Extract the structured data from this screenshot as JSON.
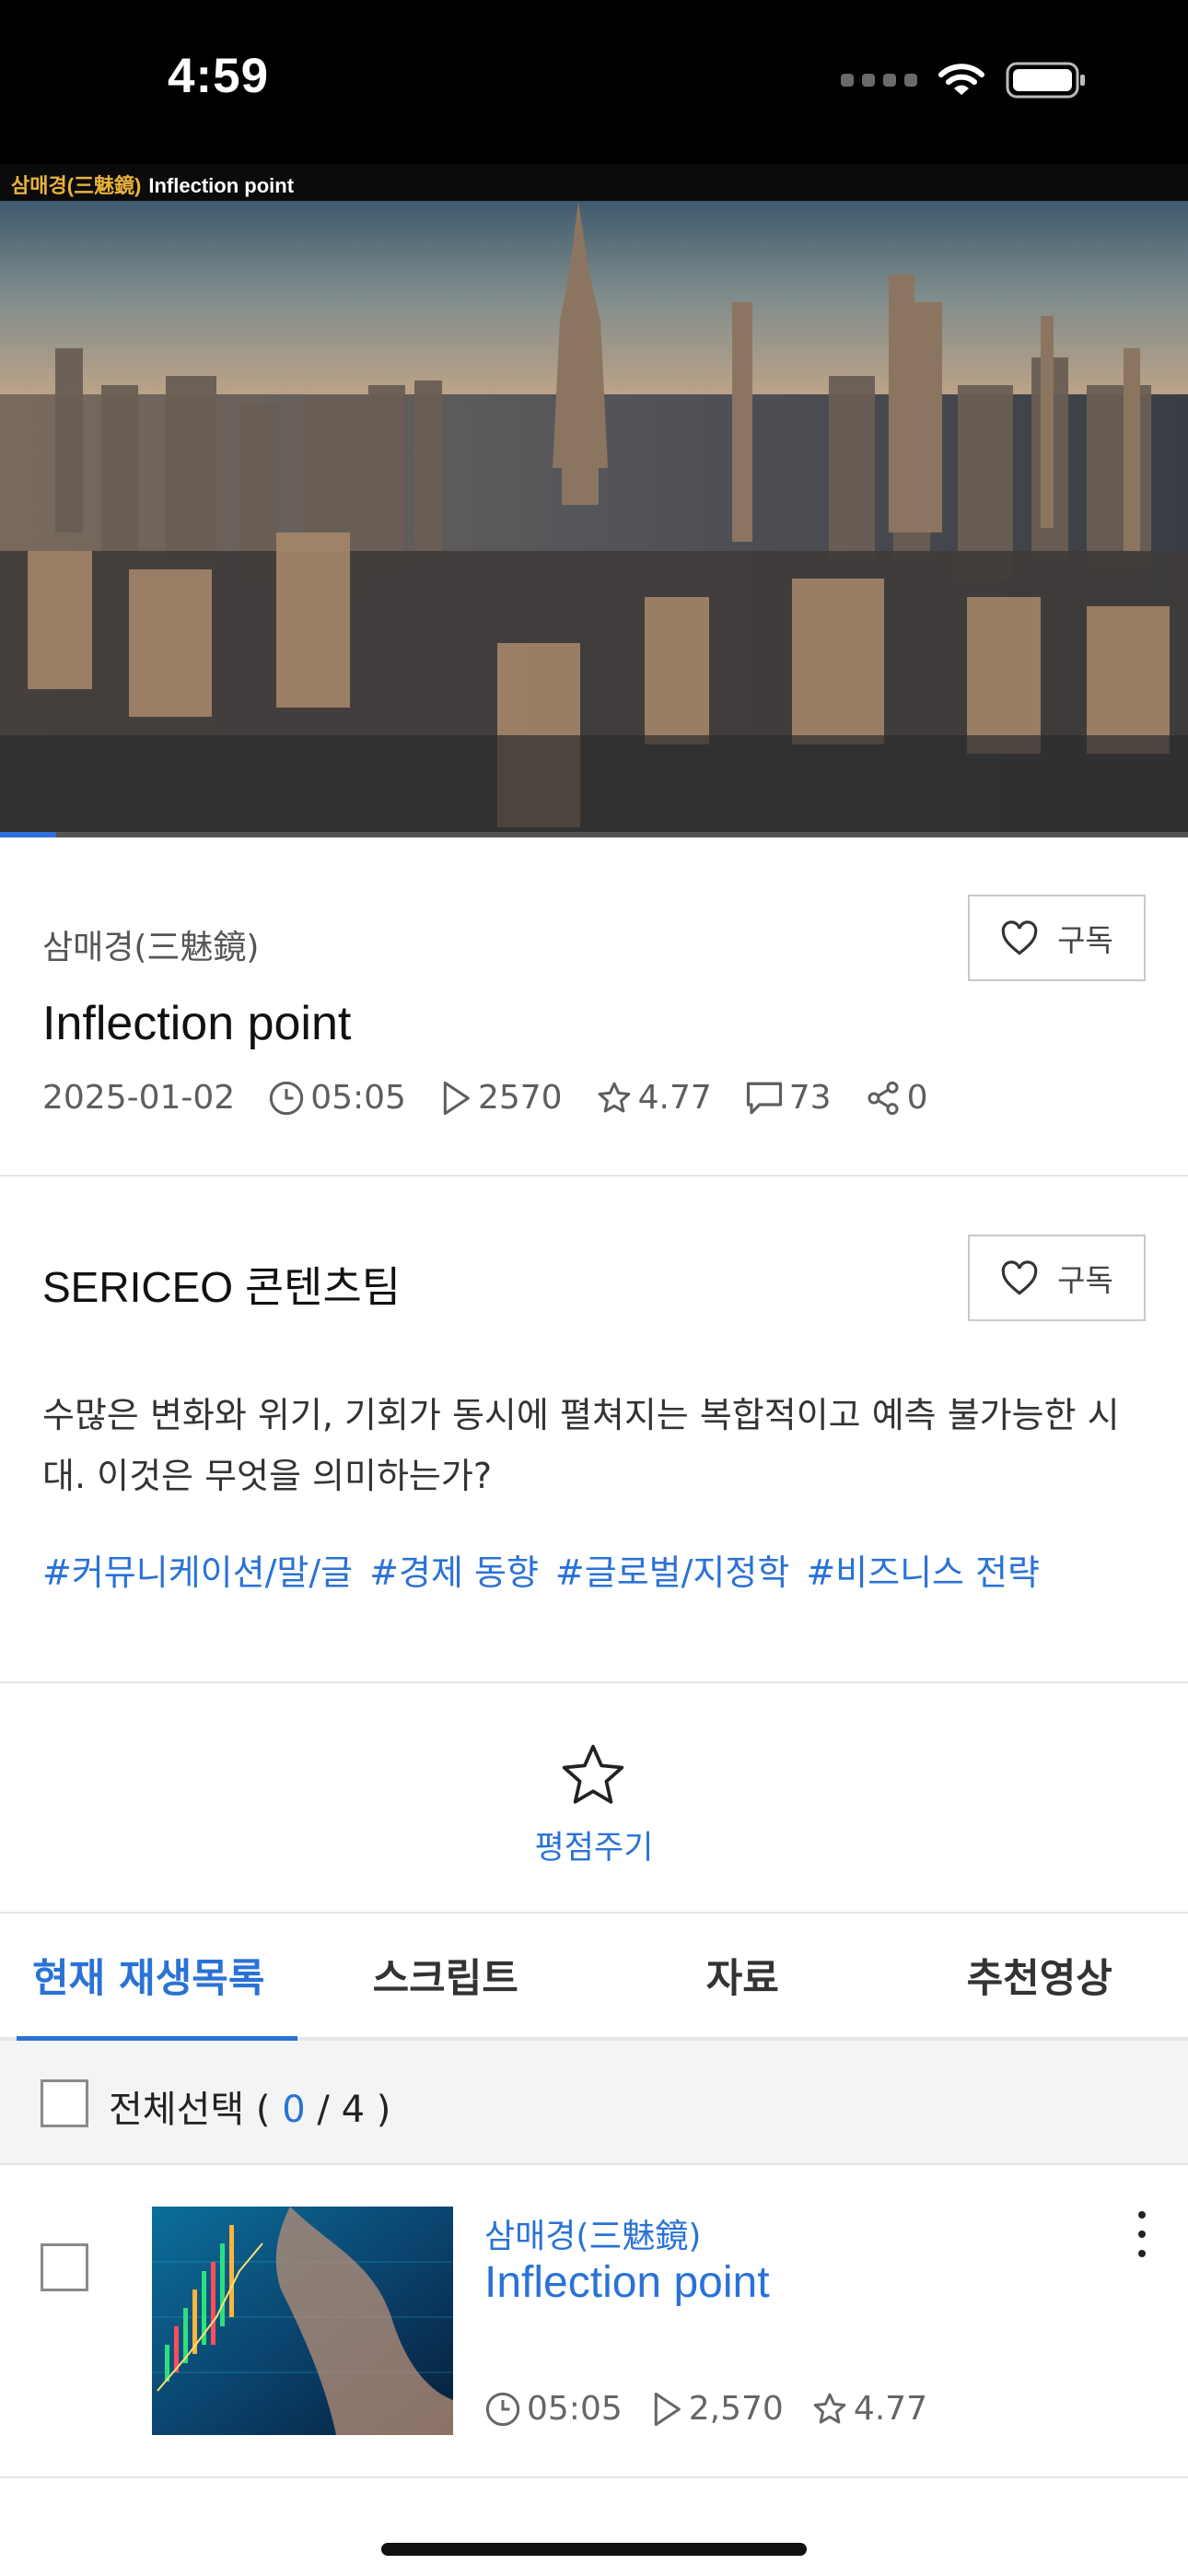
{
  "status_bar": {
    "time": "4:59"
  },
  "video": {
    "overlay_channel": "삼매경(三魅鏡)",
    "overlay_title": "Inflection point",
    "progress_fraction": 0.047
  },
  "info": {
    "channel": "삼매경(三魅鏡)",
    "title": "Inflection point",
    "subscribe_label": "구독",
    "date": "2025-01-02",
    "duration": "05:05",
    "views": "2570",
    "rating": "4.77",
    "comments": "73",
    "shares": "0"
  },
  "creator": {
    "name": "SERICEO 콘텐츠팀",
    "subscribe_label": "구독",
    "description": "수많은 변화와 위기, 기회가 동시에 펼쳐지는 복합적이고 예측 불가능한 시대. 이것은 무엇을 의미하는가?",
    "tags": [
      "#커뮤니케이션/말/글",
      "#경제 동향",
      "#글로벌/지정학",
      "#비즈니스 전략"
    ]
  },
  "rating_action": {
    "label": "평점주기"
  },
  "tabs": [
    {
      "label": "현재 재생목록",
      "active": true
    },
    {
      "label": "스크립트",
      "active": false
    },
    {
      "label": "자료",
      "active": false
    },
    {
      "label": "추천영상",
      "active": false
    }
  ],
  "select_all": {
    "label": "전체선택",
    "open": "(",
    "selected": "0",
    "separator": "/",
    "total": "4",
    "close": ")"
  },
  "playlist": [
    {
      "channel": "삼매경(三魅鏡)",
      "title": "Inflection point",
      "duration": "05:05",
      "views": "2,570",
      "rating": "4.77"
    }
  ],
  "colors": {
    "accent": "#2a72d6",
    "caption_channel": "#e9b23a"
  }
}
